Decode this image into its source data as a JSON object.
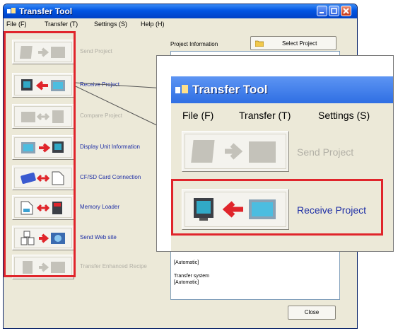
{
  "window": {
    "title": "Transfer Tool",
    "controls": [
      "minimize",
      "maximize",
      "close"
    ]
  },
  "menu": [
    "File (F)",
    "Transfer (T)",
    "Settings (S)",
    "Help (H)"
  ],
  "left_buttons": [
    {
      "label": "Send Project",
      "enabled": false,
      "icon": "send-project-icon"
    },
    {
      "label": "Receive Project",
      "enabled": true,
      "icon": "receive-project-icon"
    },
    {
      "label": "Compare Project",
      "enabled": false,
      "icon": "compare-project-icon"
    },
    {
      "label": "Display Unit Information",
      "enabled": true,
      "icon": "display-unit-info-icon"
    },
    {
      "label": "CF/SD Card Connection",
      "enabled": true,
      "icon": "cf-sd-card-icon"
    },
    {
      "label": "Memory Loader",
      "enabled": true,
      "icon": "memory-loader-icon"
    },
    {
      "label": "Send Web site",
      "enabled": true,
      "icon": "send-web-site-icon"
    },
    {
      "label": "Transfer Enhanced Recipe",
      "enabled": false,
      "icon": "transfer-recipe-icon"
    }
  ],
  "project": {
    "label": "Project Information",
    "select_button": "Select Project"
  },
  "info_panel": {
    "line1": "[Automatic]",
    "line2": "Transfer system",
    "line3": "[Automatic]"
  },
  "close_button": "Close",
  "zoom": {
    "title": "Transfer Tool",
    "menu": [
      "File (F)",
      "Transfer (T)",
      "Settings (S)"
    ],
    "buttons": [
      {
        "label": "Send Project",
        "enabled": false
      },
      {
        "label": "Receive Project",
        "enabled": true
      }
    ]
  },
  "colors": {
    "highlight": "#e0252b",
    "titlebar": "#0054e3",
    "link": "#1f2fa6",
    "disabled": "#b2b0a6"
  }
}
